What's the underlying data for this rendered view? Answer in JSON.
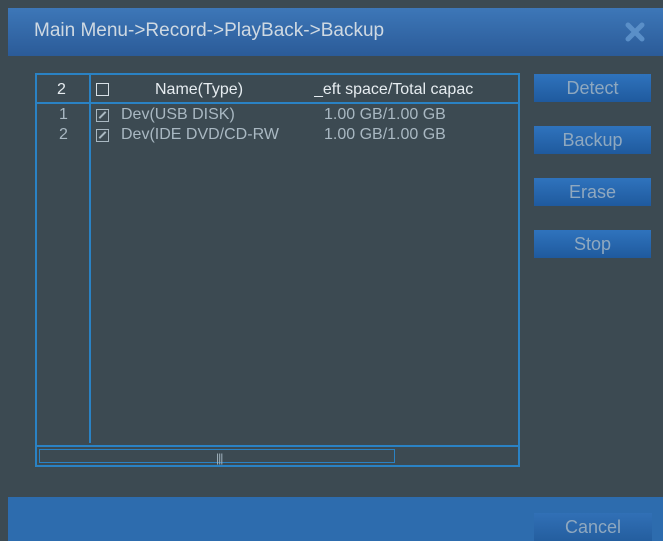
{
  "window": {
    "title": "Main Menu->Record->PlayBack->Backup",
    "close_icon": "close-icon"
  },
  "device_list": {
    "header": {
      "count": "2",
      "select_all_checked": false,
      "name_col": "Name(Type)",
      "space_col": "_eft space/Total capac"
    },
    "rows": [
      {
        "index": "1",
        "checked": true,
        "name": "Dev(USB DISK)",
        "space": "1.00 GB/1.00 GB"
      },
      {
        "index": "2",
        "checked": true,
        "name": "Dev(IDE DVD/CD-RW",
        "space": "1.00 GB/1.00 GB"
      }
    ],
    "scrollbar_grip": "|||"
  },
  "buttons": {
    "detect": "Detect",
    "backup": "Backup",
    "erase": "Erase",
    "stop": "Stop",
    "cancel": "Cancel"
  },
  "colors": {
    "accent_blue": "#2a82c4",
    "background": "#3c4a52",
    "button_text": "#8fa8bf"
  }
}
